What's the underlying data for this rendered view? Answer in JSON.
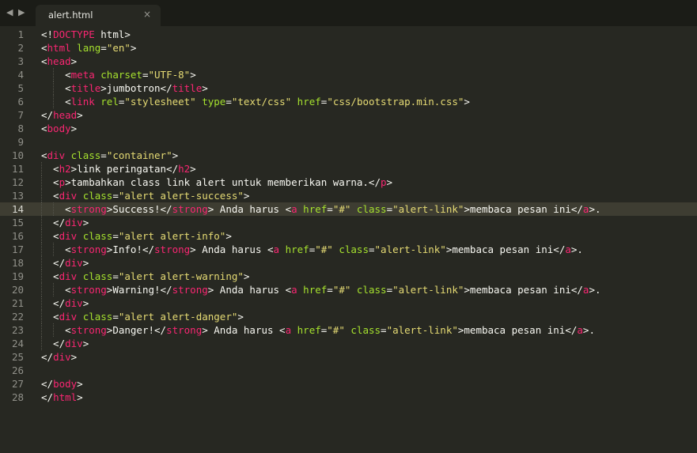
{
  "tabbar": {
    "back_icon": "◀",
    "forward_icon": "▶",
    "tab_title": "alert.html",
    "close_icon": "×"
  },
  "editor": {
    "current_line": 14,
    "lines": [
      {
        "n": "1",
        "tokens": [
          [
            "p",
            "<!"
          ],
          [
            "t",
            "DOCTYPE"
          ],
          [
            "p",
            " html>"
          ]
        ]
      },
      {
        "n": "2",
        "tokens": [
          [
            "p",
            "<"
          ],
          [
            "t",
            "html"
          ],
          [
            "p",
            " "
          ],
          [
            "a",
            "lang"
          ],
          [
            "p",
            "="
          ],
          [
            "s",
            "\"en\""
          ],
          [
            "p",
            ">"
          ]
        ]
      },
      {
        "n": "3",
        "tokens": [
          [
            "p",
            "<"
          ],
          [
            "t",
            "head"
          ],
          [
            "p",
            ">"
          ]
        ]
      },
      {
        "n": "4",
        "tokens": [
          [
            "p",
            "    <"
          ],
          [
            "t",
            "meta"
          ],
          [
            "p",
            " "
          ],
          [
            "a",
            "charset"
          ],
          [
            "p",
            "="
          ],
          [
            "s",
            "\"UTF-8\""
          ],
          [
            "p",
            ">"
          ]
        ]
      },
      {
        "n": "5",
        "tokens": [
          [
            "p",
            "    <"
          ],
          [
            "t",
            "title"
          ],
          [
            "p",
            ">jumbotron</"
          ],
          [
            "t",
            "title"
          ],
          [
            "p",
            ">"
          ]
        ]
      },
      {
        "n": "6",
        "tokens": [
          [
            "p",
            "    <"
          ],
          [
            "t",
            "link"
          ],
          [
            "p",
            " "
          ],
          [
            "a",
            "rel"
          ],
          [
            "p",
            "="
          ],
          [
            "s",
            "\"stylesheet\""
          ],
          [
            "p",
            " "
          ],
          [
            "a",
            "type"
          ],
          [
            "p",
            "="
          ],
          [
            "s",
            "\"text/css\""
          ],
          [
            "p",
            " "
          ],
          [
            "a",
            "href"
          ],
          [
            "p",
            "="
          ],
          [
            "s",
            "\"css/bootstrap.min.css\""
          ],
          [
            "p",
            ">"
          ]
        ]
      },
      {
        "n": "7",
        "tokens": [
          [
            "p",
            "</"
          ],
          [
            "t",
            "head"
          ],
          [
            "p",
            ">"
          ]
        ]
      },
      {
        "n": "8",
        "tokens": [
          [
            "p",
            "<"
          ],
          [
            "t",
            "body"
          ],
          [
            "p",
            ">"
          ]
        ]
      },
      {
        "n": "9",
        "tokens": []
      },
      {
        "n": "10",
        "tokens": [
          [
            "p",
            "<"
          ],
          [
            "t",
            "div"
          ],
          [
            "p",
            " "
          ],
          [
            "a",
            "class"
          ],
          [
            "p",
            "="
          ],
          [
            "s",
            "\"container\""
          ],
          [
            "p",
            ">"
          ]
        ]
      },
      {
        "n": "11",
        "tokens": [
          [
            "p",
            "  <"
          ],
          [
            "t",
            "h2"
          ],
          [
            "p",
            ">link peringatan</"
          ],
          [
            "t",
            "h2"
          ],
          [
            "p",
            ">"
          ]
        ]
      },
      {
        "n": "12",
        "tokens": [
          [
            "p",
            "  <"
          ],
          [
            "t",
            "p"
          ],
          [
            "p",
            ">tambahkan class link alert untuk memberikan warna.</"
          ],
          [
            "t",
            "p"
          ],
          [
            "p",
            ">"
          ]
        ]
      },
      {
        "n": "13",
        "tokens": [
          [
            "p",
            "  <"
          ],
          [
            "t",
            "div"
          ],
          [
            "p",
            " "
          ],
          [
            "a",
            "class"
          ],
          [
            "p",
            "="
          ],
          [
            "s",
            "\"alert alert-success\""
          ],
          [
            "p",
            ">"
          ]
        ]
      },
      {
        "n": "14",
        "tokens": [
          [
            "p",
            "    <"
          ],
          [
            "t",
            "strong"
          ],
          [
            "p",
            ">Success!</"
          ],
          [
            "t",
            "strong"
          ],
          [
            "p",
            "> Anda harus <"
          ],
          [
            "t",
            "a"
          ],
          [
            "p",
            " "
          ],
          [
            "a",
            "href"
          ],
          [
            "p",
            "="
          ],
          [
            "s",
            "\"#\""
          ],
          [
            "p",
            " "
          ],
          [
            "a",
            "class"
          ],
          [
            "p",
            "="
          ],
          [
            "s",
            "\"alert-link\""
          ],
          [
            "p",
            ">membaca pesan ini</"
          ],
          [
            "t",
            "a"
          ],
          [
            "p",
            ">."
          ]
        ]
      },
      {
        "n": "15",
        "tokens": [
          [
            "p",
            "  </"
          ],
          [
            "t",
            "div"
          ],
          [
            "p",
            ">"
          ]
        ]
      },
      {
        "n": "16",
        "tokens": [
          [
            "p",
            "  <"
          ],
          [
            "t",
            "div"
          ],
          [
            "p",
            " "
          ],
          [
            "a",
            "class"
          ],
          [
            "p",
            "="
          ],
          [
            "s",
            "\"alert alert-info\""
          ],
          [
            "p",
            ">"
          ]
        ]
      },
      {
        "n": "17",
        "tokens": [
          [
            "p",
            "    <"
          ],
          [
            "t",
            "strong"
          ],
          [
            "p",
            ">Info!</"
          ],
          [
            "t",
            "strong"
          ],
          [
            "p",
            "> Anda harus <"
          ],
          [
            "t",
            "a"
          ],
          [
            "p",
            " "
          ],
          [
            "a",
            "href"
          ],
          [
            "p",
            "="
          ],
          [
            "s",
            "\"#\""
          ],
          [
            "p",
            " "
          ],
          [
            "a",
            "class"
          ],
          [
            "p",
            "="
          ],
          [
            "s",
            "\"alert-link\""
          ],
          [
            "p",
            ">membaca pesan ini</"
          ],
          [
            "t",
            "a"
          ],
          [
            "p",
            ">."
          ]
        ]
      },
      {
        "n": "18",
        "tokens": [
          [
            "p",
            "  </"
          ],
          [
            "t",
            "div"
          ],
          [
            "p",
            ">"
          ]
        ]
      },
      {
        "n": "19",
        "tokens": [
          [
            "p",
            "  <"
          ],
          [
            "t",
            "div"
          ],
          [
            "p",
            " "
          ],
          [
            "a",
            "class"
          ],
          [
            "p",
            "="
          ],
          [
            "s",
            "\"alert alert-warning\""
          ],
          [
            "p",
            ">"
          ]
        ]
      },
      {
        "n": "20",
        "tokens": [
          [
            "p",
            "    <"
          ],
          [
            "t",
            "strong"
          ],
          [
            "p",
            ">Warning!</"
          ],
          [
            "t",
            "strong"
          ],
          [
            "p",
            "> Anda harus <"
          ],
          [
            "t",
            "a"
          ],
          [
            "p",
            " "
          ],
          [
            "a",
            "href"
          ],
          [
            "p",
            "="
          ],
          [
            "s",
            "\"#\""
          ],
          [
            "p",
            " "
          ],
          [
            "a",
            "class"
          ],
          [
            "p",
            "="
          ],
          [
            "s",
            "\"alert-link\""
          ],
          [
            "p",
            ">membaca pesan ini</"
          ],
          [
            "t",
            "a"
          ],
          [
            "p",
            ">."
          ]
        ]
      },
      {
        "n": "21",
        "tokens": [
          [
            "p",
            "  </"
          ],
          [
            "t",
            "div"
          ],
          [
            "p",
            ">"
          ]
        ]
      },
      {
        "n": "22",
        "tokens": [
          [
            "p",
            "  <"
          ],
          [
            "t",
            "div"
          ],
          [
            "p",
            " "
          ],
          [
            "a",
            "class"
          ],
          [
            "p",
            "="
          ],
          [
            "s",
            "\"alert alert-danger\""
          ],
          [
            "p",
            ">"
          ]
        ]
      },
      {
        "n": "23",
        "tokens": [
          [
            "p",
            "    <"
          ],
          [
            "t",
            "strong"
          ],
          [
            "p",
            ">Danger!</"
          ],
          [
            "t",
            "strong"
          ],
          [
            "p",
            "> Anda harus <"
          ],
          [
            "t",
            "a"
          ],
          [
            "p",
            " "
          ],
          [
            "a",
            "href"
          ],
          [
            "p",
            "="
          ],
          [
            "s",
            "\"#\""
          ],
          [
            "p",
            " "
          ],
          [
            "a",
            "class"
          ],
          [
            "p",
            "="
          ],
          [
            "s",
            "\"alert-link\""
          ],
          [
            "p",
            ">membaca pesan ini</"
          ],
          [
            "t",
            "a"
          ],
          [
            "p",
            ">."
          ]
        ]
      },
      {
        "n": "24",
        "tokens": [
          [
            "p",
            "  </"
          ],
          [
            "t",
            "div"
          ],
          [
            "p",
            ">"
          ]
        ]
      },
      {
        "n": "25",
        "tokens": [
          [
            "p",
            "</"
          ],
          [
            "t",
            "div"
          ],
          [
            "p",
            ">"
          ]
        ]
      },
      {
        "n": "26",
        "tokens": []
      },
      {
        "n": "27",
        "tokens": [
          [
            "p",
            "</"
          ],
          [
            "t",
            "body"
          ],
          [
            "p",
            ">"
          ]
        ]
      },
      {
        "n": "28",
        "tokens": [
          [
            "p",
            "</"
          ],
          [
            "t",
            "html"
          ],
          [
            "p",
            ">"
          ]
        ]
      }
    ]
  }
}
